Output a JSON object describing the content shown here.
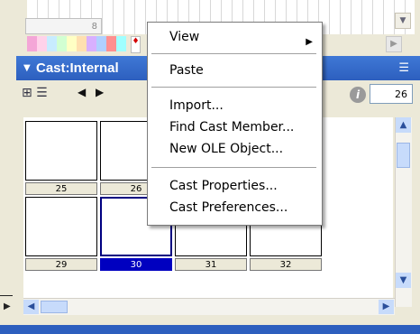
{
  "score": {
    "frame_number": "8",
    "color_swatches": [
      "#f4a6d7",
      "#ffd2ea",
      "#c8ecff",
      "#d2ffd2",
      "#ffffc4",
      "#ffe0b0",
      "#d8b0ff",
      "#b0d0ff",
      "#ff9090",
      "#a0ffff"
    ],
    "playhead_glyph": "♦"
  },
  "cast_window": {
    "title": "Cast:Internal",
    "collapse_glyph": "▼",
    "menu_glyph": "☰",
    "member_number": "26",
    "info_glyph": "i",
    "view_toggle_glyph": "⊞ ☰",
    "nav_prev_glyph": "◀",
    "nav_next_glyph": "▶",
    "members": [
      {
        "number": "25"
      },
      {
        "number": "26"
      },
      {
        "number": ""
      },
      {
        "number": ""
      },
      {
        "number": "29"
      },
      {
        "number": "30",
        "selected": true
      },
      {
        "number": "31"
      },
      {
        "number": "32"
      }
    ]
  },
  "context_menu": {
    "items": [
      {
        "label": "View",
        "submenu": true
      },
      {
        "label": "Paste"
      },
      {
        "label": "Import..."
      },
      {
        "label": "Find Cast Member..."
      },
      {
        "label": "New OLE Object..."
      },
      {
        "label": "Cast Properties..."
      },
      {
        "label": "Cast Preferences..."
      }
    ],
    "submenu_glyph": "▶"
  },
  "scroll": {
    "up_glyph": "▲",
    "down_glyph": "▼",
    "left_glyph": "◀",
    "right_glyph": "▶"
  }
}
